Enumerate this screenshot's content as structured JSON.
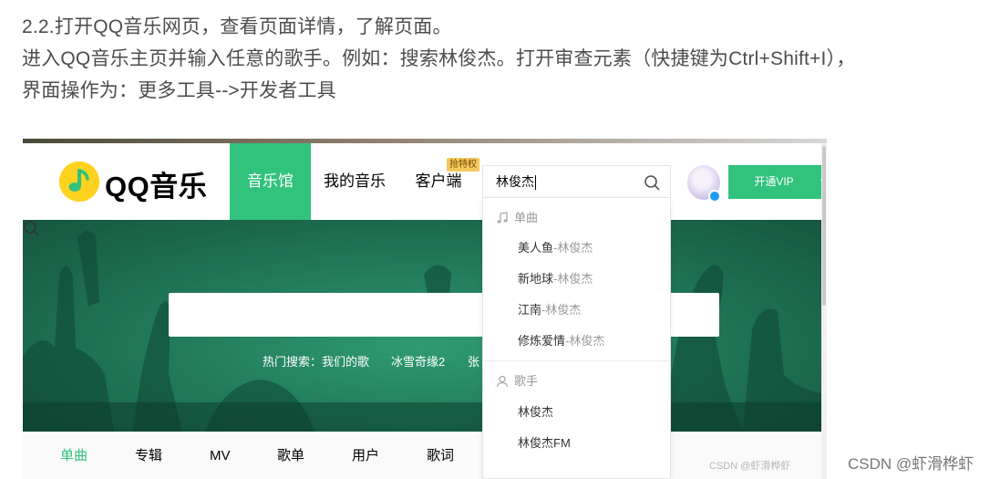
{
  "article": {
    "line1": "2.2.打开QQ音乐网页，查看页面详情，了解页面。",
    "line2": "进入QQ音乐主页并输入任意的歌手。例如：搜索林俊杰。打开审查元素（快捷键为Ctrl+Shift+I），",
    "line3": "界面操作为：更多工具-->开发者工具"
  },
  "header": {
    "logo": "QQ音乐",
    "nav": [
      "音乐馆",
      "我的音乐",
      "客户端"
    ],
    "client_badge": "抢特权",
    "search_value": "林俊杰",
    "vip_button": "开通VIP",
    "vip_arrow": "▾"
  },
  "banner": {
    "hot_label": "热门搜索：",
    "hot_items": [
      "我们的歌",
      "冰雪奇缘2",
      "张"
    ]
  },
  "dropdown": {
    "songs_header": "单曲",
    "songs": [
      {
        "title": "美人鱼",
        "artist": "-林俊杰"
      },
      {
        "title": "新地球",
        "artist": "-林俊杰"
      },
      {
        "title": "江南",
        "artist": "-林俊杰"
      },
      {
        "title": "修炼爱情",
        "artist": "-林俊杰"
      }
    ],
    "singers_header": "歌手",
    "singers": [
      "林俊杰",
      "林俊杰FM"
    ]
  },
  "tabs": [
    "单曲",
    "专辑",
    "MV",
    "歌单",
    "用户",
    "歌词"
  ],
  "watermarks": {
    "inner": "CSDN @虾滑桦虾",
    "outer": "CSDN @虾滑桦虾"
  },
  "colors": {
    "accent": "#31c27c",
    "logo_yellow": "#ffd21f",
    "banner_green": "#217a5a"
  }
}
